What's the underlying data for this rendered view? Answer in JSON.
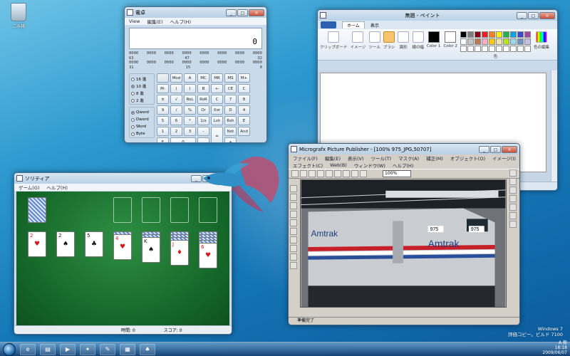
{
  "desktop": {
    "recycle_bin_label": "ごみ箱"
  },
  "calculator": {
    "title": "電卓",
    "menu": [
      "View",
      "編集(E)",
      "ヘルプ(H)"
    ],
    "display": "0",
    "bits_rows": [
      [
        "0000",
        "0000",
        "0000",
        "0000",
        "0000",
        "0000",
        "0000",
        "0000"
      ],
      [
        "63",
        "",
        "",
        "47",
        "",
        "",
        "",
        "32"
      ],
      [
        "0000",
        "0000",
        "0000",
        "0000",
        "0000",
        "0000",
        "0000",
        "0000"
      ],
      [
        "31",
        "",
        "",
        "15",
        "",
        "",
        "",
        "0"
      ]
    ],
    "base_options": [
      "16 進",
      "10 進",
      "8 進",
      "2 進"
    ],
    "base_selected": "10 進",
    "word_options": [
      "Qword",
      "Dword",
      "Word",
      "Byte"
    ],
    "word_selected": "Qword",
    "keys": [
      [
        "",
        "Mod",
        "A",
        "MC",
        "MR",
        "MS",
        "M+",
        "M-"
      ],
      [
        "(",
        ")",
        "B",
        "←",
        "CE",
        "C",
        "±",
        "√"
      ],
      [
        "RoL",
        "RoR",
        "C",
        "7",
        "8",
        "9",
        "/",
        "%"
      ],
      [
        "Or",
        "Xor",
        "D",
        "4",
        "5",
        "6",
        "*",
        "1/x"
      ],
      [
        "Lsh",
        "Rsh",
        "E",
        "1",
        "2",
        "3",
        "-",
        "="
      ],
      [
        "Not",
        "And",
        "F",
        "0",
        ".",
        "+"
      ]
    ]
  },
  "paint": {
    "title": "無題 - ペイント",
    "tabs": [
      "ホーム",
      "表示"
    ],
    "groups": [
      "クリップボード",
      "イメージ",
      "ツール",
      "ブラシ",
      "図形",
      "線の幅",
      "Color 1",
      "Color 2",
      "色",
      "色の編集"
    ],
    "palette": [
      "#000000",
      "#7f7f7f",
      "#880015",
      "#ed1c24",
      "#ff7f27",
      "#fff200",
      "#22b14c",
      "#00a2e8",
      "#3f48cc",
      "#a349a4",
      "#ffffff",
      "#c3c3c3",
      "#b97a57",
      "#ffaec9",
      "#ffc90e",
      "#efe4b0",
      "#b5e61d",
      "#99d9ea",
      "#7092be",
      "#c8bfe7",
      "#ffffff",
      "#ffffff",
      "#ffffff",
      "#ffffff",
      "#ffffff",
      "#ffffff",
      "#ffffff",
      "#ffffff",
      "#ffffff",
      "#ffffff"
    ]
  },
  "solitaire": {
    "title": "ソリティア",
    "menu": [
      "ゲーム(G)",
      "ヘルプ(H)"
    ],
    "time_label": "時間:",
    "time_value": "0",
    "score_label": "スコア:",
    "score_value": "0"
  },
  "picture_publisher": {
    "title": "Micrografx Picture Publisher - [100% 975_JPG,50707]",
    "menu_row1": [
      "ファイル(F)",
      "編集(E)",
      "表示(V)",
      "ツール(T)",
      "マスク(A)",
      "補正(M)",
      "オブジェクト(O)",
      "イメージ(I)"
    ],
    "menu_row2": [
      "エフェクト(C)",
      "Web(B)",
      "ウィンドウ(W)",
      "ヘルプ(H)"
    ],
    "zoom": "100%",
    "status": "準備完了",
    "photo_text": [
      "Amtrak",
      "Amtrak",
      "975",
      "975"
    ]
  },
  "watermark": {
    "line1": "Windows 7",
    "line2": "評価コピー。ビルド 7100"
  },
  "tray": {
    "time": "18:18",
    "date": "2009/06/07",
    "lang": "A 般"
  }
}
